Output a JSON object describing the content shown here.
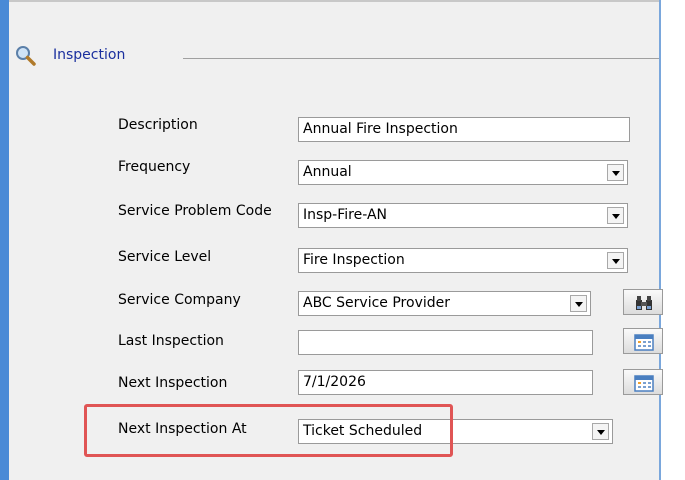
{
  "section": {
    "title": "Inspection",
    "icon": "magnifier-icon"
  },
  "fields": {
    "description": {
      "label": "Description",
      "value": "Annual Fire Inspection"
    },
    "frequency": {
      "label": "Frequency",
      "value": "Annual"
    },
    "service_problem_code": {
      "label": "Service Problem Code",
      "value": "Insp-Fire-AN"
    },
    "service_level": {
      "label": "Service Level",
      "value": "Fire Inspection"
    },
    "service_company": {
      "label": "Service Company",
      "value": "ABC Service Provider",
      "button_icon": "binoculars-icon"
    },
    "last_inspection": {
      "label": "Last Inspection",
      "value": "",
      "button_icon": "calendar-icon"
    },
    "next_inspection": {
      "label": "Next Inspection",
      "value": "7/1/2026",
      "button_icon": "calendar-icon"
    },
    "next_inspection_at": {
      "label": "Next Inspection At",
      "value": "Ticket Scheduled"
    }
  },
  "colors": {
    "section_title": "#1a2f9e",
    "window_border": "#4a8ad6",
    "highlight": "#e05555"
  }
}
